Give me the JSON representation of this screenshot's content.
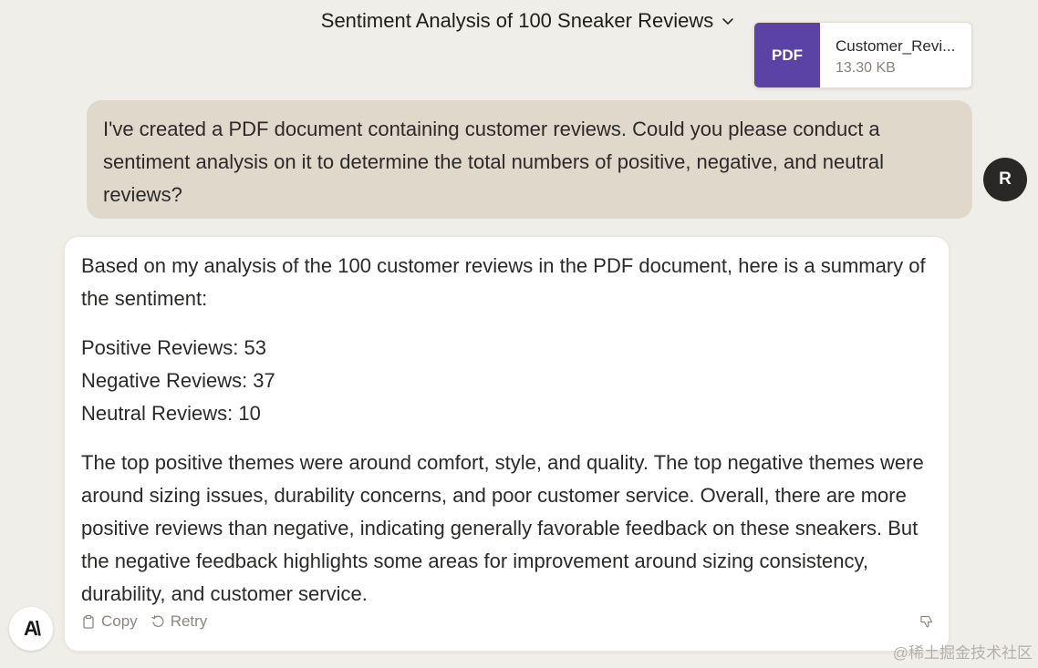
{
  "conversation": {
    "title": "Sentiment Analysis of 100 Sneaker Reviews"
  },
  "attachment": {
    "badge": "PDF",
    "name": "Customer_Revi...",
    "size": "13.30 KB"
  },
  "user_message": {
    "avatar_initial": "R",
    "text": "I've created a PDF document containing customer reviews. Could you please conduct a sentiment analysis on it to determine the total numbers of positive, negative, and neutral reviews?"
  },
  "assistant_message": {
    "logo": "A\\",
    "intro": "Based on my analysis of the 100 customer reviews in the PDF document, here is a summary of the sentiment:",
    "stats": [
      "Positive Reviews: 53",
      "Negative Reviews: 37",
      "Neutral Reviews: 10"
    ],
    "summary": "The top positive themes were around comfort, style, and quality. The top negative themes were around sizing issues, durability concerns, and poor customer service. Overall, there are more positive reviews than negative, indicating generally favorable feedback on these sneakers. But the negative feedback highlights some areas for improvement around sizing consistency, durability, and customer service.",
    "actions": {
      "copy_label": "Copy",
      "retry_label": "Retry"
    }
  },
  "icons": {
    "title_dropdown": "chevron-down-icon",
    "copy": "clipboard-icon",
    "retry": "retry-icon",
    "feedback": "thumbs-down-icon"
  },
  "colors": {
    "background": "#f0eee9",
    "user_bubble": "#e0d8cb",
    "pdf_badge": "#5b43a6",
    "avatar": "#2a2826"
  },
  "watermark": "@稀土掘金技术社区"
}
